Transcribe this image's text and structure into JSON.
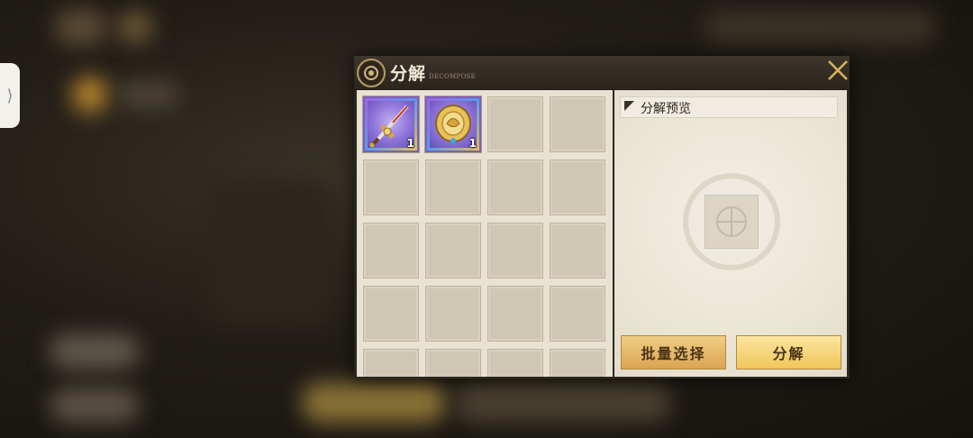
{
  "panel": {
    "title": "分解",
    "subtitle": "DECOMPOSE",
    "close_icon": "close-icon"
  },
  "side_tab": {
    "glyph": "⟩"
  },
  "inventory": {
    "columns": 4,
    "items": [
      {
        "name": "sword",
        "icon": "sword-icon",
        "count": "1",
        "rarity_color": "#8d72d8"
      },
      {
        "name": "amulet",
        "icon": "amulet-icon",
        "count": "1",
        "rarity_color": "#8d72d8"
      }
    ]
  },
  "preview": {
    "label": "分解预览",
    "icon": "decompose-wheel-icon"
  },
  "buttons": {
    "batch_select": "批量选择",
    "decompose": "分解"
  },
  "colors": {
    "accent_gold": "#d9b15c",
    "button_gold": "#f1c55a"
  }
}
